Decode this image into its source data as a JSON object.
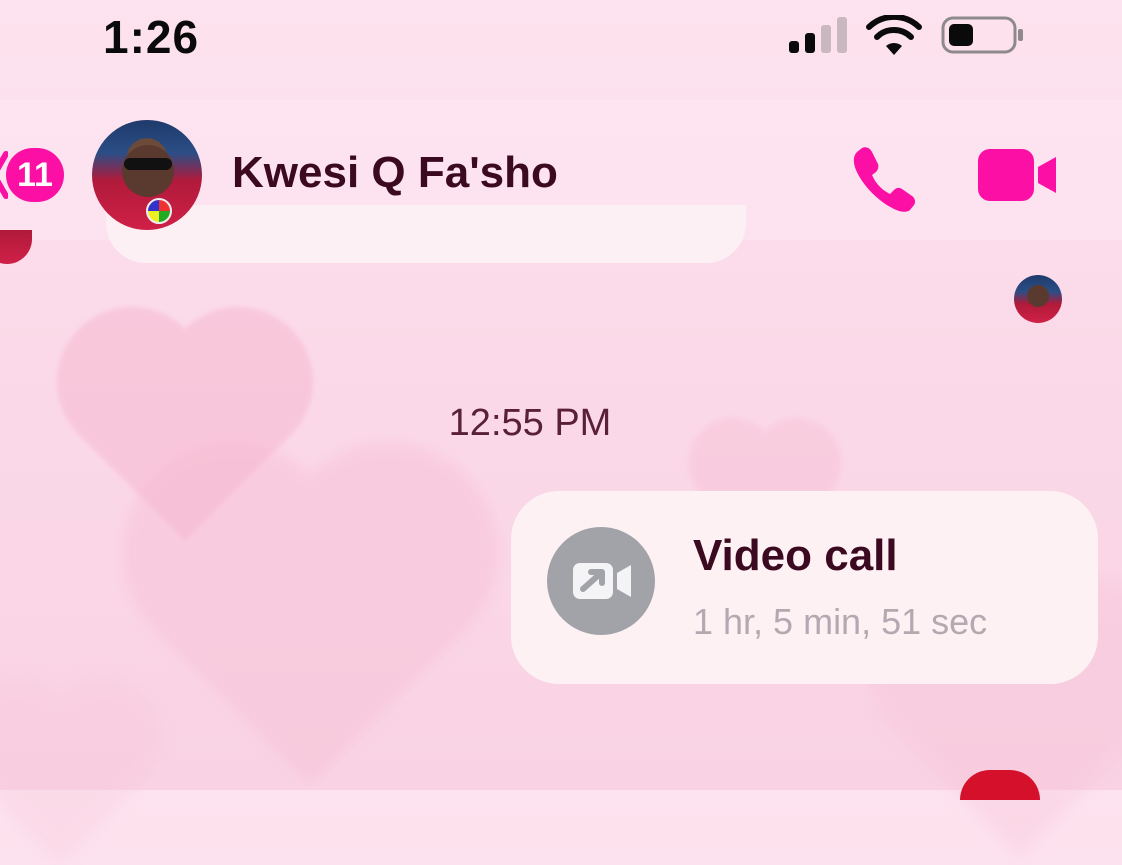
{
  "status_bar": {
    "time": "1:26",
    "icons": [
      "cellular-signal-icon",
      "wifi-icon",
      "battery-icon"
    ]
  },
  "header": {
    "back_badge_count": "11",
    "contact_name": "Kwesi Q Fa'sho",
    "actions": [
      "phone-icon",
      "video-camera-icon"
    ],
    "accent_color": "#fb0fa4"
  },
  "conversation": {
    "timestamp": "12:55 PM",
    "call_message": {
      "title": "Video call",
      "duration": "1 hr, 5 min, 51 sec",
      "icon": "video-call-outgoing-icon"
    }
  },
  "theme": {
    "background": "pink hearts",
    "text_color": "#3b0a20",
    "secondary_text_color": "#b6a8b0"
  }
}
